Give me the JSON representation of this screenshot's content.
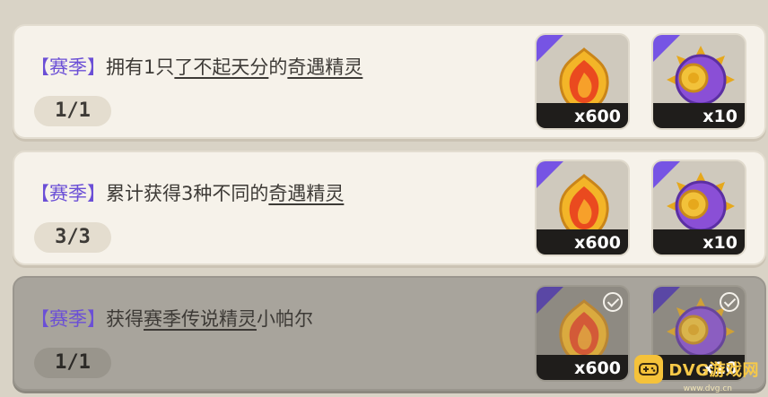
{
  "tasks": [
    {
      "tag": "【赛季】",
      "text_parts": [
        "拥有1只",
        "了不起天分",
        "的",
        "奇遇精灵",
        ""
      ],
      "progress": "1/1",
      "rewards": [
        {
          "icon": "fire-crest-icon",
          "qty": "x600"
        },
        {
          "icon": "purple-spiked-coin-icon",
          "qty": "x10"
        }
      ],
      "claimed": false
    },
    {
      "tag": "【赛季】",
      "text_parts": [
        "累计获得3种不同的",
        "奇遇精灵",
        "",
        "",
        ""
      ],
      "progress": "3/3",
      "rewards": [
        {
          "icon": "fire-crest-icon",
          "qty": "x600"
        },
        {
          "icon": "purple-spiked-coin-icon",
          "qty": "x10"
        }
      ],
      "claimed": false
    },
    {
      "tag": "【赛季】",
      "text_parts": [
        "获得",
        "赛季传说精灵",
        "小帕尔",
        "",
        ""
      ],
      "progress": "1/1",
      "rewards": [
        {
          "icon": "fire-crest-icon",
          "qty": "x600"
        },
        {
          "icon": "purple-spiked-coin-icon",
          "qty": "x10"
        }
      ],
      "claimed": true
    }
  ],
  "watermark": {
    "text": "DVG游戏网",
    "sub": "www.dvg.cn"
  },
  "colors": {
    "tag": "#6b4fd6",
    "corner": "#7654e4",
    "card": "#f6f2ea",
    "card_done": "#a8a49c"
  }
}
